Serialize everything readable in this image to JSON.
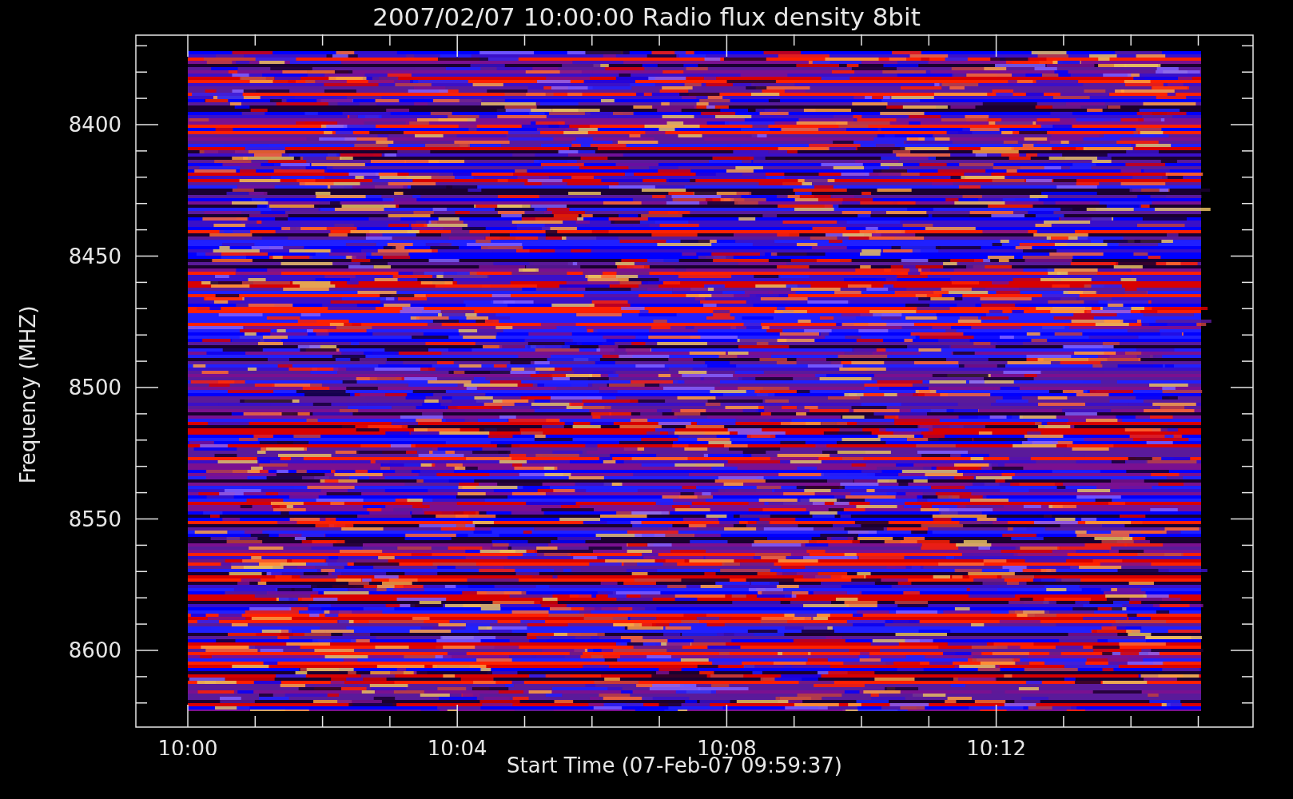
{
  "title": "2007/02/07 10:00:00 Radio flux density 8bit",
  "ylabel": "Frequency (MHZ)",
  "xlabel": "Start Time (07-Feb-07 09:59:37)",
  "yticks": [
    "8400",
    "8450",
    "8500",
    "8550",
    "8600"
  ],
  "xticks": [
    "10:00",
    "10:04",
    "10:08",
    "10:12"
  ]
}
